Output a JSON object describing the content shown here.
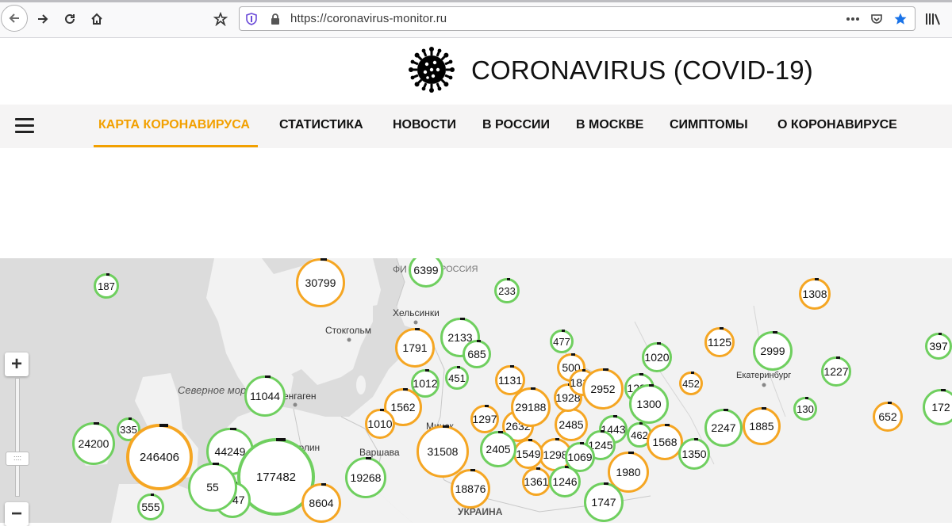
{
  "browser": {
    "url": "https://coronavirus-monitor.ru"
  },
  "site": {
    "title": "CORONAVIRUS (COVID-19)"
  },
  "nav": {
    "items": [
      {
        "label": "КАРТА КОРОНАВИРУСА",
        "active": true
      },
      {
        "label": "СТАТИСТИКА"
      },
      {
        "label": "НОВОСТИ"
      },
      {
        "label": "В РОССИИ"
      },
      {
        "label": "В МОСКВЕ"
      },
      {
        "label": "СИМПТОМЫ"
      },
      {
        "label": "О КОРОНАВИРУСЕ"
      }
    ]
  },
  "map": {
    "labels": {
      "helsinki": "Хельсинки",
      "stockholm": "Стокгольм",
      "north_sea": "Северное море",
      "copenhagen": "енгаген",
      "berlin": "Берлин",
      "warsaw": "Варшава",
      "minsk": "Минск",
      "ukraine": "УКРАИНА",
      "yekaterinburg": "Екатеринбург",
      "finland": "ФИ",
      "russia": "РОССИЯ"
    },
    "zoom": {
      "in": "+",
      "out": "−"
    },
    "bubbles": [
      {
        "value": "187",
        "color": "#6fcf5f"
      },
      {
        "value": "30799",
        "color": "#f5a623"
      },
      {
        "value": "6399",
        "color": "#6fcf5f"
      },
      {
        "value": "233",
        "color": "#6fcf5f"
      },
      {
        "value": "1308",
        "color": "#f5a623"
      },
      {
        "value": "1791",
        "color": "#f5a623"
      },
      {
        "value": "2133",
        "color": "#6fcf5f"
      },
      {
        "value": "685",
        "color": "#6fcf5f"
      },
      {
        "value": "477",
        "color": "#6fcf5f"
      },
      {
        "value": "1020",
        "color": "#6fcf5f"
      },
      {
        "value": "1125",
        "color": "#f5a623"
      },
      {
        "value": "2999",
        "color": "#6fcf5f"
      },
      {
        "value": "397",
        "color": "#6fcf5f"
      },
      {
        "value": "1012",
        "color": "#6fcf5f"
      },
      {
        "value": "451",
        "color": "#6fcf5f"
      },
      {
        "value": "1131",
        "color": "#f5a623"
      },
      {
        "value": "500",
        "color": "#f5a623"
      },
      {
        "value": "1285",
        "color": "#6fcf5f"
      },
      {
        "value": "452",
        "color": "#f5a623"
      },
      {
        "value": "1227",
        "color": "#6fcf5f"
      },
      {
        "value": "11044",
        "color": "#6fcf5f"
      },
      {
        "value": "1562",
        "color": "#f5a623"
      },
      {
        "value": "130",
        "color": "#6fcf5f"
      },
      {
        "value": "652",
        "color": "#f5a623"
      },
      {
        "value": "1297",
        "color": "#f5a623"
      },
      {
        "value": "1010",
        "color": "#f5a623"
      },
      {
        "value": "2632",
        "color": "#f5a623"
      },
      {
        "value": "2485",
        "color": "#f5a623"
      },
      {
        "value": "1443",
        "color": "#6fcf5f"
      },
      {
        "value": "462",
        "color": "#6fcf5f"
      },
      {
        "value": "1568",
        "color": "#f5a623"
      },
      {
        "value": "2247",
        "color": "#6fcf5f"
      },
      {
        "value": "1885",
        "color": "#f5a623"
      },
      {
        "value": "24200",
        "color": "#6fcf5f"
      },
      {
        "value": "335",
        "color": "#6fcf5f"
      },
      {
        "value": "246406",
        "color": "#f5a623"
      },
      {
        "value": "44249",
        "color": "#6fcf5f"
      },
      {
        "value": "31508",
        "color": "#f5a623"
      },
      {
        "value": "1298",
        "color": "#f5a623"
      },
      {
        "value": "1245",
        "color": "#6fcf5f"
      },
      {
        "value": "1350",
        "color": "#6fcf5f"
      },
      {
        "value": "177482",
        "color": "#6fcf5f"
      },
      {
        "value": "19268",
        "color": "#6fcf5f"
      },
      {
        "value": "18876",
        "color": "#f5a623"
      },
      {
        "value": "1361",
        "color": "#f5a623"
      },
      {
        "value": "1246",
        "color": "#6fcf5f"
      },
      {
        "value": "1980",
        "color": "#f5a623"
      },
      {
        "value": "555",
        "color": "#6fcf5f"
      },
      {
        "value": "3947",
        "color": "#6fcf5f"
      },
      {
        "value": "8604",
        "color": "#f5a623"
      },
      {
        "value": "1747",
        "color": "#6fcf5f"
      },
      {
        "value": "29188",
        "color": "#f5a623"
      },
      {
        "value": "1928",
        "color": "#f5a623"
      },
      {
        "value": "1813",
        "color": "#f5a623"
      },
      {
        "value": "2952",
        "color": "#f5a623"
      },
      {
        "value": "1300",
        "color": "#6fcf5f"
      },
      {
        "value": "172",
        "color": "#6fcf5f"
      },
      {
        "value": "1549",
        "color": "#f5a623"
      },
      {
        "value": "2405",
        "color": "#6fcf5f"
      },
      {
        "value": "1069",
        "color": "#6fcf5f"
      },
      {
        "value": "55",
        "color": "#6fcf5f"
      }
    ]
  }
}
